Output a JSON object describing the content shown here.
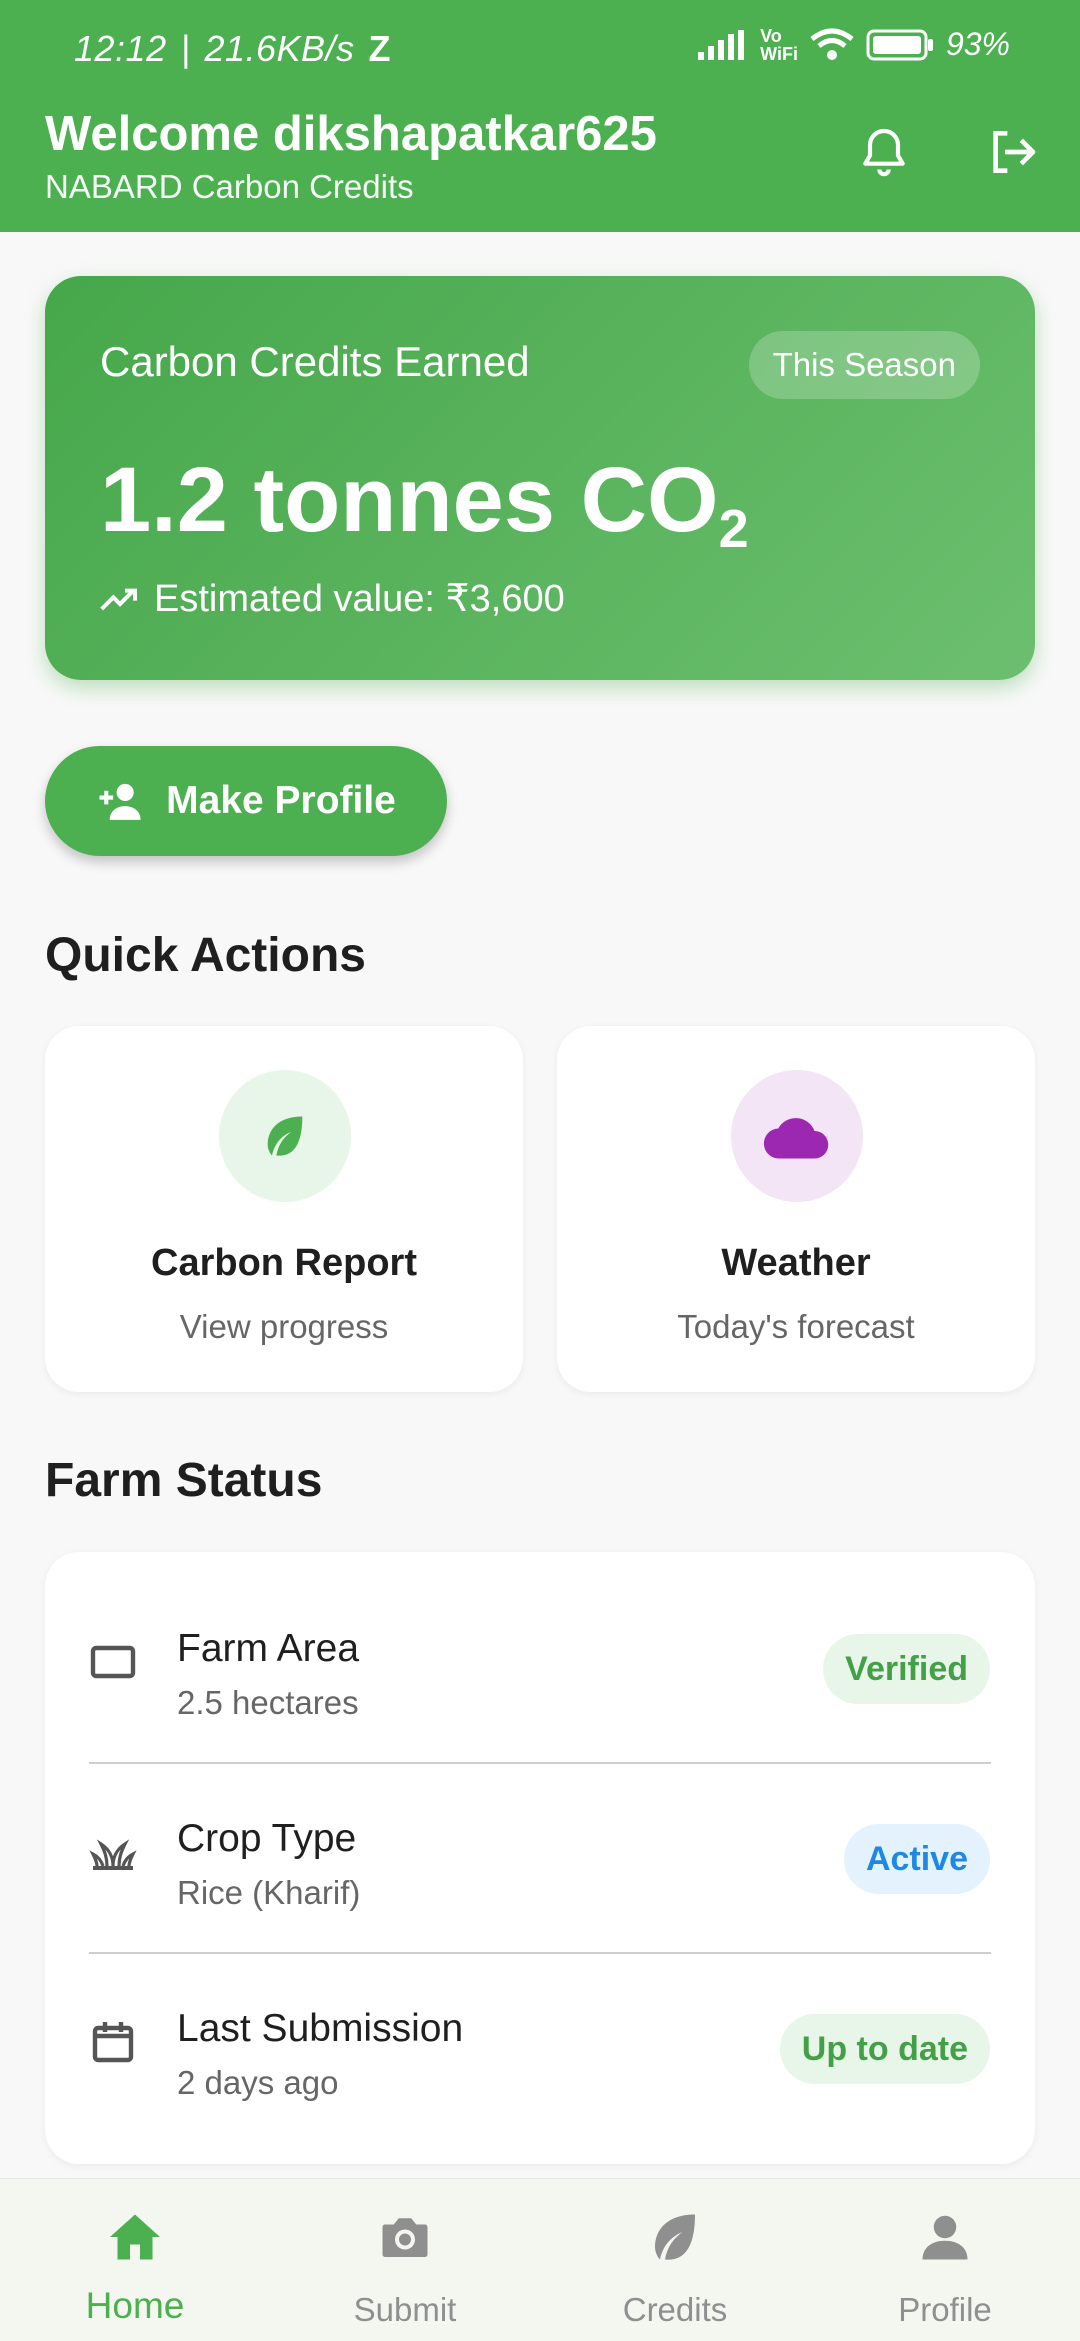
{
  "status_bar": {
    "time": "12:12",
    "speed": "21.6KB/s",
    "battery": "93%"
  },
  "header": {
    "welcome": "Welcome dikshapatkar625",
    "subtitle": "NABARD Carbon Credits",
    "bell_icon": "bell-icon",
    "logout_icon": "logout-icon"
  },
  "credits_card": {
    "title": "Carbon Credits Earned",
    "badge": "This Season",
    "value": "1.2 tonnes CO",
    "value_sub": "2",
    "estimated": "Estimated value: ₹3,600"
  },
  "make_profile": {
    "label": "Make Profile"
  },
  "quick_actions": {
    "title": "Quick Actions",
    "items": [
      {
        "title": "Carbon Report",
        "subtitle": "View progress",
        "icon": "leaf-icon",
        "color": "#4caf50",
        "bg": "#e8f5e9"
      },
      {
        "title": "Weather",
        "subtitle": "Today's forecast",
        "icon": "cloud-icon",
        "color": "#9c27b0",
        "bg": "#f3e5f5"
      }
    ]
  },
  "farm_status": {
    "title": "Farm Status",
    "rows": [
      {
        "title": "Farm Area",
        "subtitle": "2.5 hectares",
        "badge": "Verified",
        "icon": "square-outline-icon"
      },
      {
        "title": "Crop Type",
        "subtitle": "Rice (Kharif)",
        "badge": "Active",
        "icon": "grass-icon"
      },
      {
        "title": "Last Submission",
        "subtitle": "2 days ago",
        "badge": "Up to date",
        "icon": "calendar-icon"
      }
    ]
  },
  "bottom_nav": {
    "items": [
      {
        "label": "Home",
        "icon": "home-icon"
      },
      {
        "label": "Submit",
        "icon": "camera-icon"
      },
      {
        "label": "Credits",
        "icon": "leaf-icon"
      },
      {
        "label": "Profile",
        "icon": "person-icon"
      }
    ]
  },
  "colors": {
    "primary": "#4caf50",
    "active_blue": "#1e88e5"
  }
}
